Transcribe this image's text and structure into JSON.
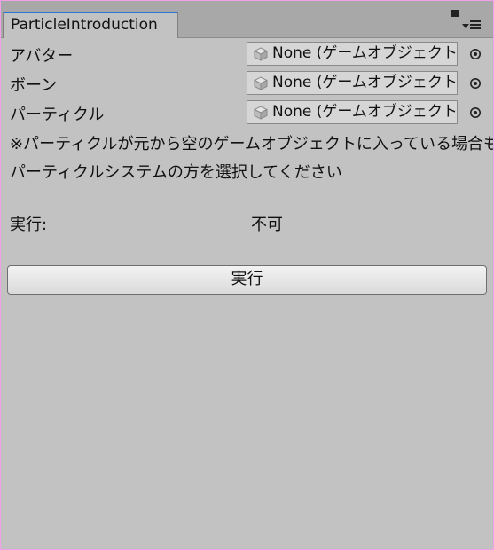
{
  "window": {
    "tab_title": "ParticleIntroduction"
  },
  "fields": [
    {
      "label": "アバター",
      "value": "None (ゲームオブジェクト)"
    },
    {
      "label": "ボーン",
      "value": "None (ゲームオブジェクト)"
    },
    {
      "label": "パーティクル",
      "value": "None (ゲームオブジェクト)"
    }
  ],
  "note": {
    "line1": "※パーティクルが元から空のゲームオブジェクトに入っている場合も",
    "line2": "パーティクルシステムの方を選択してください"
  },
  "execution": {
    "label": "実行:",
    "status": "不可"
  },
  "run_button": {
    "label": "実行"
  },
  "colors": {
    "panel_bg": "#c2c2c2",
    "tab_accent": "#2a75d8",
    "outer_border": "#f0a0e8"
  },
  "icons": {
    "field_icon": "gameobject-cube-icon",
    "picker_icon": "object-picker-icon",
    "maximize_icon": "maximize-icon",
    "menu_icon": "tab-menu-icon"
  }
}
